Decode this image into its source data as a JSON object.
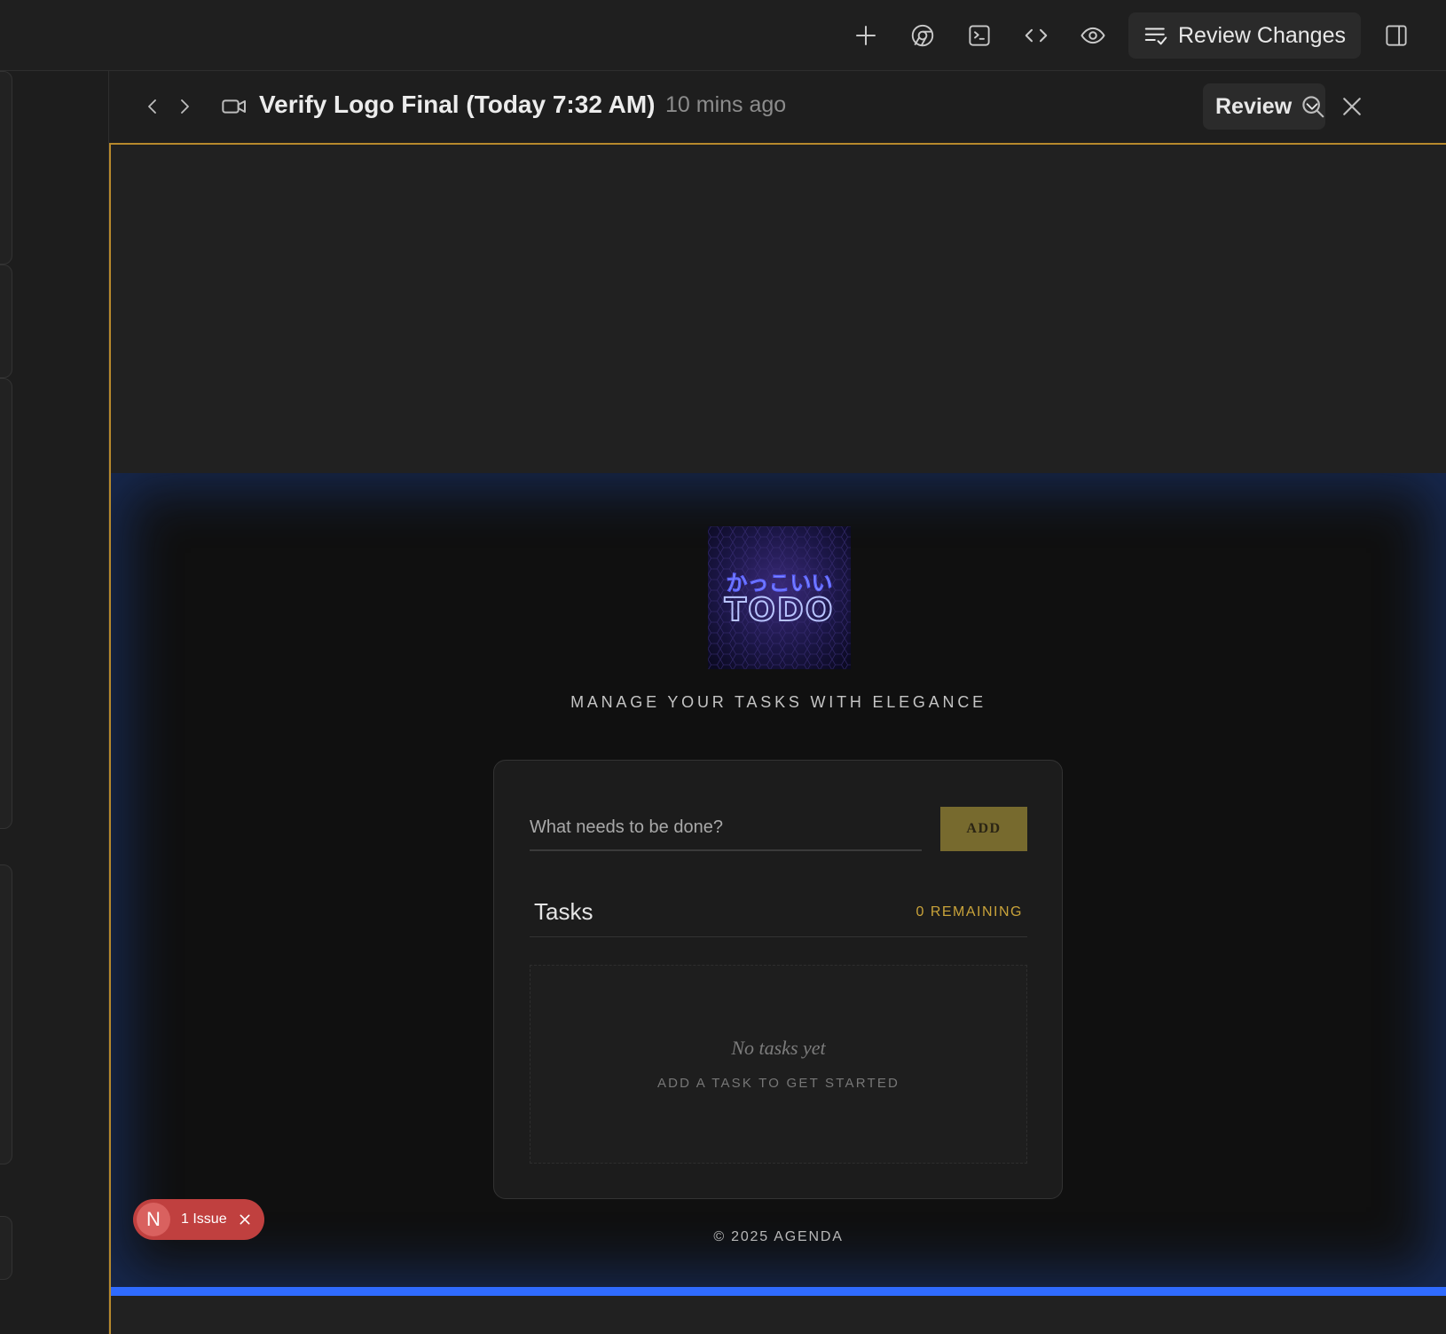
{
  "toolbar": {
    "icons": [
      "plus-icon",
      "chrome-icon",
      "terminal-icon",
      "code-icon",
      "eye-icon"
    ],
    "review_changes_label": "Review Changes",
    "sidebar_toggle_icon": "sidebar-right-icon"
  },
  "panel": {
    "title": "Verify Logo Final (Today 7:32 AM)",
    "time_ago": "10 mins ago",
    "review_dropdown": "Review"
  },
  "app": {
    "logo": {
      "kana": "かっこいい",
      "word": "TODO"
    },
    "tagline": "MANAGE YOUR TASKS WITH ELEGANCE",
    "input_placeholder": "What needs to be done?",
    "add_label": "ADD",
    "tasks_title": "Tasks",
    "remaining": "0 REMAINING",
    "empty_title": "No tasks yet",
    "empty_subtitle": "ADD A TASK TO GET STARTED",
    "footer": "© 2025 AGENDA"
  },
  "issue_badge": {
    "avatar_letter": "N",
    "label": "1 Issue"
  },
  "colors": {
    "accent_border": "#b7892c",
    "gold": "#c9a33a",
    "add_button": "#776a2e",
    "issue_red": "#c0403f",
    "blue_bar": "#2f6bff"
  }
}
